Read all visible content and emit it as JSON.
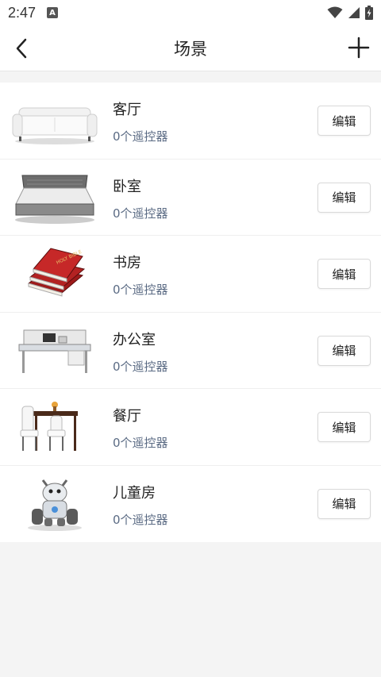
{
  "status_bar": {
    "time": "2:47",
    "notification_icon": "A"
  },
  "header": {
    "title": "场景",
    "back_icon": "chevron-left-icon",
    "add_icon": "plus-icon"
  },
  "rooms": [
    {
      "name": "客厅",
      "count": "0个遥控器",
      "edit_label": "编辑",
      "image": "sofa-image"
    },
    {
      "name": "卧室",
      "count": "0个遥控器",
      "edit_label": "编辑",
      "image": "bed-image"
    },
    {
      "name": "书房",
      "count": "0个遥控器",
      "edit_label": "编辑",
      "image": "books-image"
    },
    {
      "name": "办公室",
      "count": "0个遥控器",
      "edit_label": "编辑",
      "image": "desk-image"
    },
    {
      "name": "餐厅",
      "count": "0个遥控器",
      "edit_label": "编辑",
      "image": "dining-table-image"
    },
    {
      "name": "儿童房",
      "count": "0个遥控器",
      "edit_label": "编辑",
      "image": "toy-robot-image"
    }
  ]
}
